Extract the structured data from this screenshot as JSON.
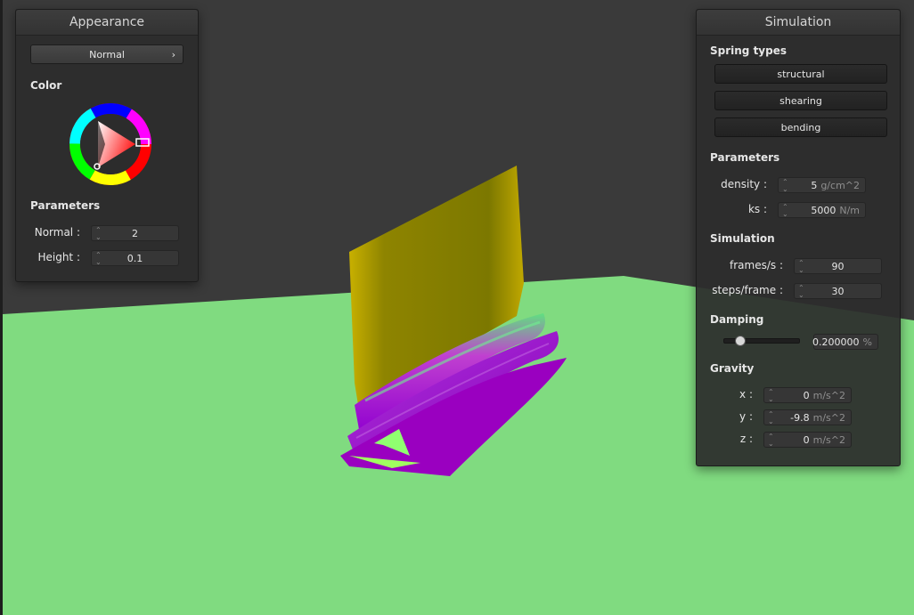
{
  "appearance": {
    "title": "Appearance",
    "shader_select": "Normal",
    "color_label": "Color",
    "params_label": "Parameters",
    "normal_label": "Normal :",
    "normal_value": "2",
    "height_label": "Height :",
    "height_value": "0.1"
  },
  "simulation": {
    "title": "Simulation",
    "spring_types_label": "Spring types",
    "spring_buttons": [
      "structural",
      "shearing",
      "bending"
    ],
    "params_label": "Parameters",
    "density_label": "density :",
    "density_value": "5",
    "density_unit": "g/cm^2",
    "ks_label": "ks :",
    "ks_value": "5000",
    "ks_unit": "N/m",
    "sim_label": "Simulation",
    "fps_label": "frames/s :",
    "fps_value": "90",
    "steps_label": "steps/frame :",
    "steps_value": "30",
    "damping_label": "Damping",
    "damping_value": "0.200000",
    "damping_unit": "%",
    "damping_fraction": 0.2,
    "gravity_label": "Gravity",
    "gx_label": "x :",
    "gx_value": "0",
    "gy_label": "y :",
    "gy_value": "-9.8",
    "gz_label": "z :",
    "gz_value": "0",
    "gravity_unit": "m/s^2"
  },
  "colors": {
    "background": "#3a3a3a",
    "ground": "#80db80",
    "cloth_back": "#8c8000",
    "cloth_fold": "#a000c8",
    "accent_red": "#e03c3c"
  }
}
